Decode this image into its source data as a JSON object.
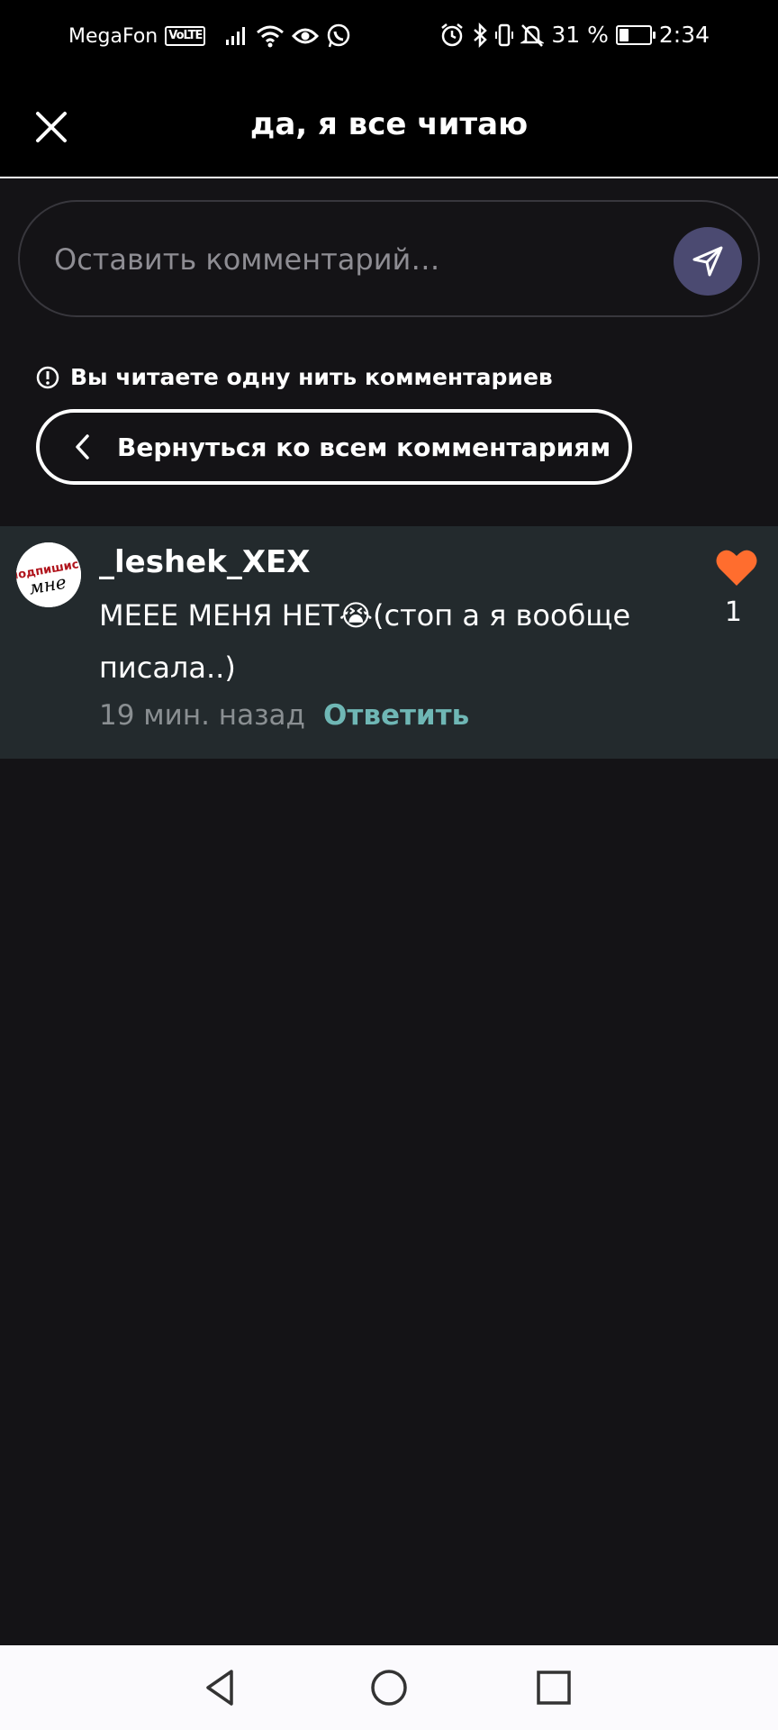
{
  "status_bar": {
    "carrier": "MegaFon",
    "volte": "VoLTE",
    "battery_percent": "31 %",
    "battery_level": 0.31,
    "time": "2:34",
    "icons": [
      "signal-icon",
      "wifi-icon",
      "eye-icon",
      "whatsapp-icon",
      "alarm-icon",
      "bluetooth-icon",
      "vibrate-icon",
      "mute-icon",
      "battery-icon"
    ]
  },
  "header": {
    "title": "да, я все читаю",
    "close_icon": "close-icon"
  },
  "comment_input": {
    "placeholder": "Оставить комментарий…",
    "value": "",
    "send_icon": "send-icon"
  },
  "thread_notice": {
    "text": "Вы читаете одну нить комментариев",
    "icon": "info-icon"
  },
  "back_button": {
    "label": "Вернуться ко всем комментариям",
    "icon": "chevron-left-icon"
  },
  "comment": {
    "username": "_leshek_XEX",
    "text": "МЕЕЕ МЕНЯ НЕТ😭(стоп а я вообще писала..)",
    "time": "19 мин. назад",
    "reply_label": "Ответить",
    "likes": "1",
    "avatar_text_top": "подпишись",
    "avatar_text_bottom": "мне",
    "like_color": "#ff6d2e"
  },
  "colors": {
    "background": "#141316",
    "comment_row_bg": "#232a2d",
    "reply_accent": "#6fb7b5",
    "send_button": "#4b4a71"
  },
  "nav_bar": {
    "icons": [
      "back-triangle-icon",
      "home-circle-icon",
      "recents-square-icon"
    ]
  }
}
